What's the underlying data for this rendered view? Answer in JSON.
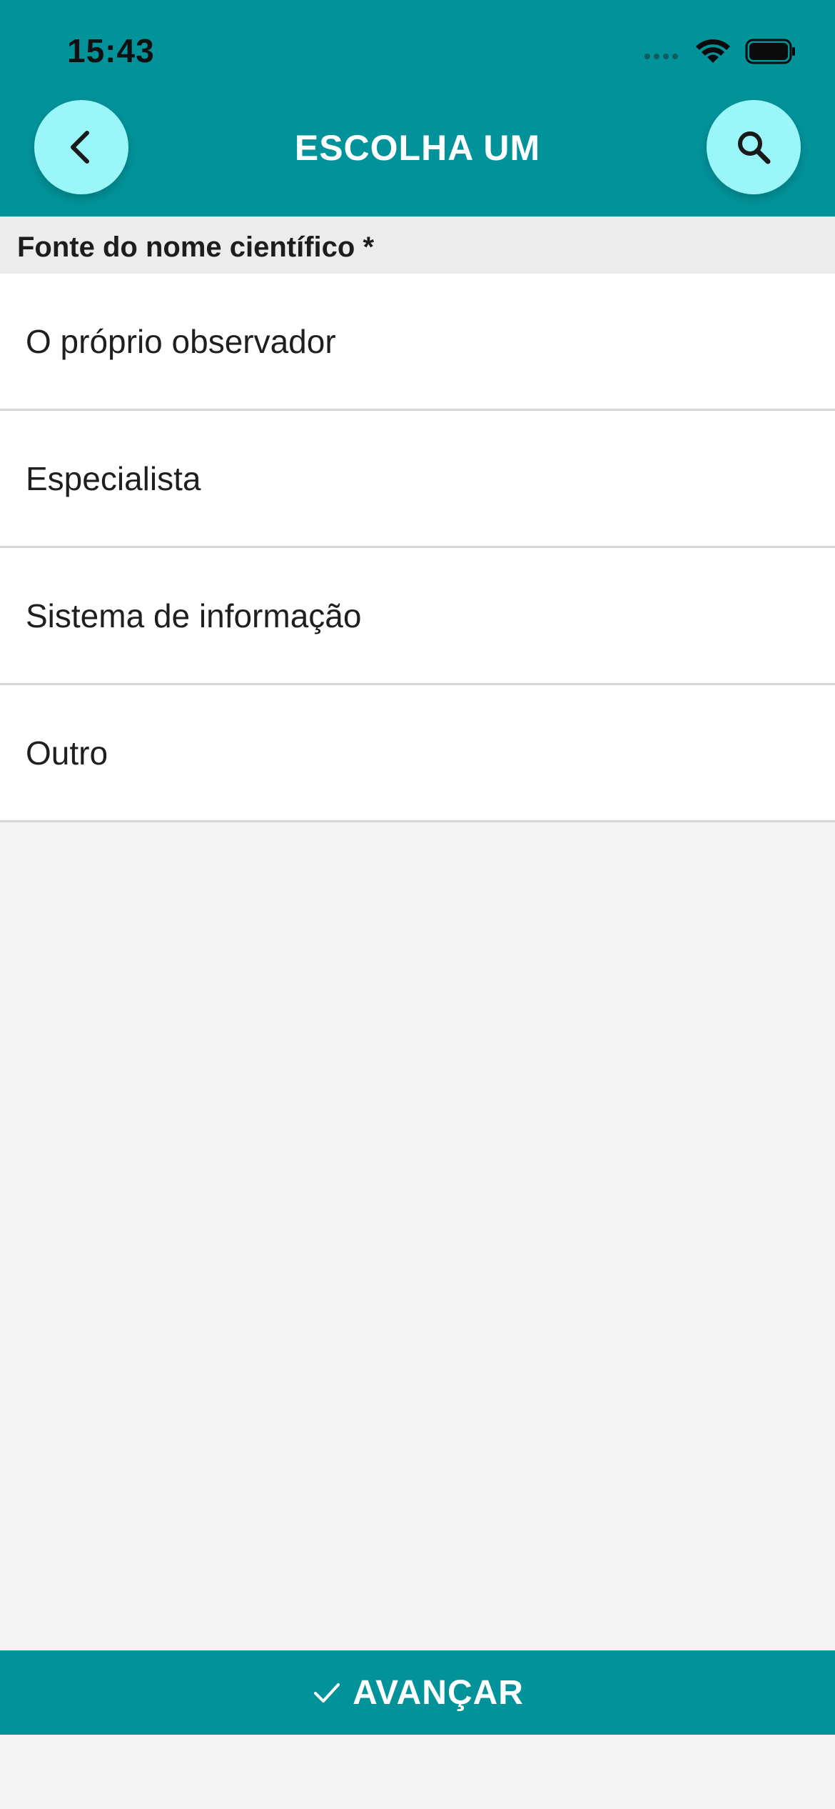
{
  "status_bar": {
    "time": "15:43"
  },
  "header": {
    "title": "ESCOLHA UM",
    "back_icon": "chevron-left-icon",
    "search_icon": "search-icon",
    "background_color": "#02939a",
    "button_color": "#9af6f8"
  },
  "section": {
    "label": "Fonte do nome científico *"
  },
  "options": [
    {
      "label": "O próprio observador"
    },
    {
      "label": "Especialista"
    },
    {
      "label": "Sistema de informação"
    },
    {
      "label": "Outro"
    }
  ],
  "footer": {
    "advance_label": "AVANÇAR",
    "advance_icon": "check-icon"
  }
}
